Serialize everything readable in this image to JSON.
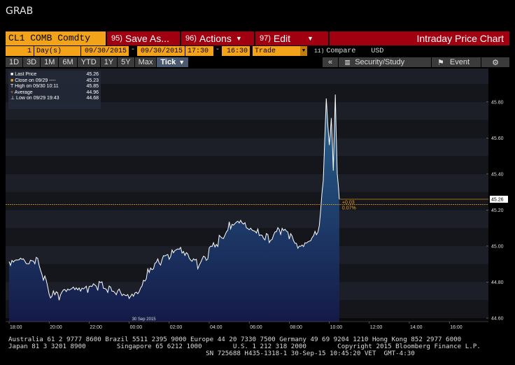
{
  "window": {
    "title": "GRAB"
  },
  "toolbar": {
    "ticker": "CL1 COMB Comdty",
    "save_num": "95)",
    "save_label": "Save As...",
    "actions_num": "96)",
    "actions_label": "Actions",
    "edit_num": "97)",
    "edit_label": "Edit",
    "chart_title": "Intraday Price Chart"
  },
  "params": {
    "period_count": "1",
    "period_unit": "Day(s)",
    "start_date": "09/30/2015",
    "end_date": "09/30/2015",
    "start_time": "17:30",
    "end_time": "16:30",
    "event_type": "Trade",
    "compare_num": "11)",
    "compare_label": "Compare",
    "currency": "USD"
  },
  "ranges": [
    "1D",
    "3D",
    "1M",
    "6M",
    "YTD",
    "1Y",
    "5Y",
    "Max"
  ],
  "active_range": "Tick",
  "right_buttons": {
    "collapse": "«",
    "security_study": "Security/Study",
    "event": "Event"
  },
  "legend": [
    {
      "label": "Last Price",
      "value": "45.26"
    },
    {
      "label": "Close on 09/29 ----",
      "value": "45.23"
    },
    {
      "label": "High on 09/30 10:11",
      "value": "45.85"
    },
    {
      "label": "Average",
      "value": "44.96"
    },
    {
      "label": "Low on 09/29 19:43",
      "value": "44.68"
    }
  ],
  "colors": {
    "accent_orange": "#f2a31a",
    "button_red": "#a0000f",
    "line_white": "#ffffff",
    "area_blue": "#1d4f7a"
  },
  "chart_data": {
    "type": "area",
    "title": "",
    "xlabel": "",
    "ylabel": "",
    "date_label": "30 Sep 2015",
    "x_ticks": [
      "18:00",
      "20:00",
      "22:00",
      "00:00",
      "02:00",
      "04:00",
      "06:00",
      "08:00",
      "10:00",
      "12:00",
      "14:00",
      "16:00"
    ],
    "y_ticks": [
      "45.80",
      "45.60",
      "45.40",
      "45.20",
      "45.00",
      "44.80",
      "44.60"
    ],
    "ylim": [
      44.6,
      45.9
    ],
    "x_hours_after_1800": [
      0,
      0.5,
      1.0,
      1.5,
      2.0,
      2.5,
      3.0,
      3.5,
      4.0,
      4.5,
      5.0,
      5.5,
      6.0,
      6.5,
      7.0,
      7.5,
      8.0,
      8.5,
      9.0,
      9.5,
      10.0,
      10.5,
      11.0,
      11.5,
      12.0,
      12.5,
      13.0,
      13.5,
      14.0,
      14.5,
      15.0,
      15.5,
      15.7,
      15.85,
      16.0,
      16.1,
      16.2,
      16.3,
      16.4,
      16.5
    ],
    "values": [
      44.9,
      44.93,
      44.91,
      44.9,
      44.72,
      44.71,
      44.74,
      44.73,
      44.75,
      44.77,
      44.75,
      44.74,
      44.72,
      44.75,
      44.86,
      44.9,
      44.94,
      44.96,
      44.91,
      44.88,
      44.95,
      45.02,
      45.1,
      45.14,
      45.1,
      45.06,
      45.02,
      45.08,
      45.04,
      44.96,
      45.0,
      45.08,
      45.35,
      45.78,
      45.55,
      45.72,
      45.42,
      45.83,
      45.4,
      45.26
    ],
    "last_price": 45.26,
    "prev_close": 45.23,
    "change_label": "+0.03",
    "change_pct_label": "0.07%",
    "last_label": "45.26"
  },
  "footer": {
    "line1": "Australia 61 2 9777 8600 Brazil 5511 2395 9000 Europe 44 20 7330 7500 Germany 49 69 9204 1210 Hong Kong 852 2977 6000",
    "line2": "Japan 81 3 3201 8900        Singapore 65 6212 1000        U.S. 1 212 318 2000        Copyright 2015 Bloomberg Finance L.P.",
    "line3": "                                                   SN 725688 H435-1318-1 30-Sep-15 10:45:20 VET  GMT-4:30"
  }
}
